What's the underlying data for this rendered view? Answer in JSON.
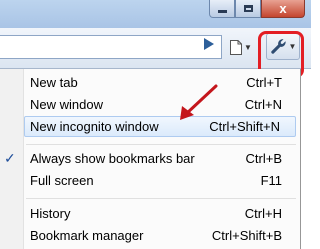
{
  "window": {
    "close_glyph": "x"
  },
  "toolbar": {
    "go_icon": "play-triangle-icon",
    "page_icon": "page-icon",
    "wrench_icon": "wrench-icon"
  },
  "menu": {
    "items": [
      {
        "label": "New tab",
        "shortcut": "Ctrl+T"
      },
      {
        "label": "New window",
        "shortcut": "Ctrl+N"
      },
      {
        "label": "New incognito window",
        "shortcut": "Ctrl+Shift+N"
      },
      {
        "label": "Always show bookmarks bar",
        "shortcut": "Ctrl+B",
        "checked": true
      },
      {
        "label": "Full screen",
        "shortcut": "F11"
      },
      {
        "label": "History",
        "shortcut": "Ctrl+H"
      },
      {
        "label": "Bookmark manager",
        "shortcut": "Ctrl+Shift+B"
      }
    ],
    "check_glyph": "✓"
  },
  "colors": {
    "annotation": "#e31e24",
    "hover_fill": "#dbeafb",
    "titlebar": "#a9c4e6"
  }
}
